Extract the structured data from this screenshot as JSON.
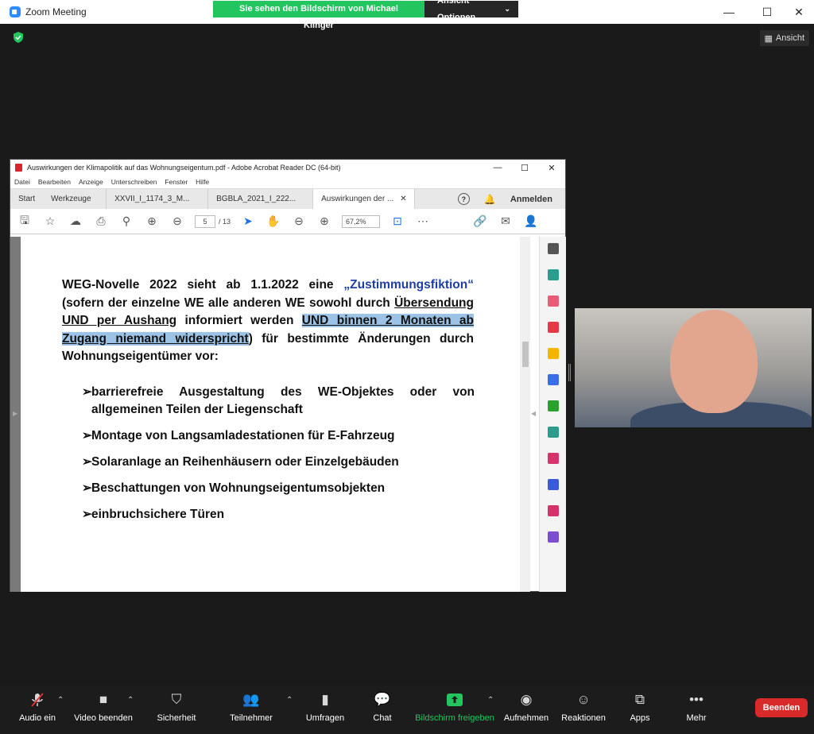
{
  "window": {
    "title": "Zoom Meeting",
    "share_banner": "Sie sehen den Bildschirm von Michael Klinger",
    "view_options": "Ansicht Optionen",
    "view_button": "Ansicht"
  },
  "acrobat": {
    "title": "Auswirkungen der Klimapolitik auf das Wohnungseigentum.pdf - Adobe Acrobat Reader DC (64-bit)",
    "menu": [
      "Datei",
      "Bearbeiten",
      "Anzeige",
      "Unterschreiben",
      "Fenster",
      "Hilfe"
    ],
    "tabs": [
      "Start",
      "Werkzeuge",
      "XXVII_I_1174_3_M...",
      "BGBLA_2021_I_222...",
      "Auswirkungen der ..."
    ],
    "login": "Anmelden",
    "page_current": "5",
    "page_total": "/ 13",
    "zoom": "67,2%"
  },
  "document": {
    "p1": "WEG-Novelle 2022 sieht ab 1.1.2022 eine ",
    "p1_blue": "„Zustimmungsfiktion“",
    "p2": " (sofern der einzelne WE alle anderen WE sowohl durch ",
    "p3_u": "Übersendung UND per Aushang",
    "p4": " informiert werden ",
    "p5_hl": "UND binnen 2 Monaten ab Zugang niemand widerspricht",
    "p6": ") für bestimmte Änderungen durch Wohnungseigentümer vor:",
    "bullets": [
      "barrierefreie Ausgestaltung des WE-Objektes oder von allgemeinen Teilen der Liegenschaft",
      "Montage von Langsamladestationen für E-Fahrzeug",
      "Solaranlage an Reihenhäusern oder Einzelgebäuden",
      "Beschattungen von Wohnungseigentumsobjekten",
      "einbruchsichere Türen"
    ]
  },
  "toolbar": {
    "audio": "Audio ein",
    "video": "Video beenden",
    "security": "Sicherheit",
    "participants": "Teilnehmer",
    "polls": "Umfragen",
    "chat": "Chat",
    "share": "Bildschirm freigeben",
    "record": "Aufnehmen",
    "reactions": "Reaktionen",
    "apps": "Apps",
    "more": "Mehr",
    "end": "Beenden"
  }
}
